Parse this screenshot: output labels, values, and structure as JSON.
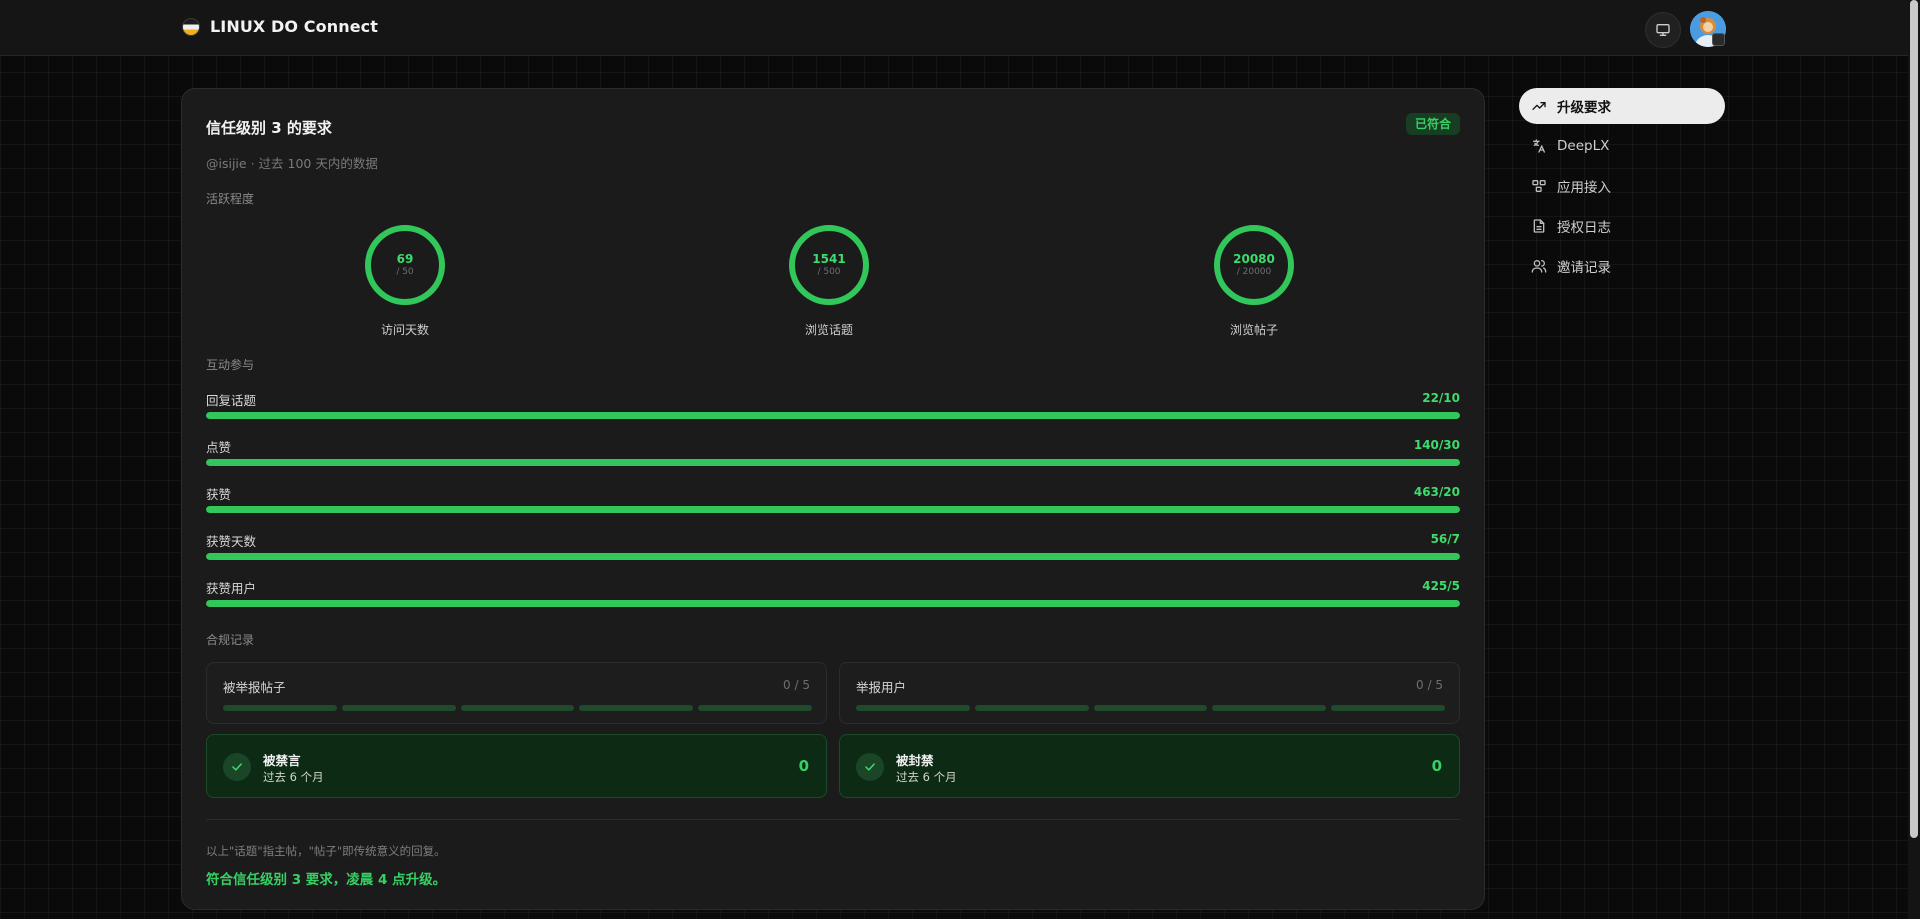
{
  "header": {
    "brand_name": "LINUX DO Connect",
    "display_icon": "monitor-icon",
    "avatar": "user-avatar"
  },
  "card": {
    "title": "信任级别 3 的要求",
    "status_badge": "已符合",
    "subtitle": "@isijie · 过去 100 天内的数据"
  },
  "activity": {
    "label": "活跃程度",
    "rings": [
      {
        "value": "69",
        "target": "/ 50",
        "label": "访问天数",
        "progress": 1.0
      },
      {
        "value": "1541",
        "target": "/ 500",
        "label": "浏览话题",
        "progress": 1.0
      },
      {
        "value": "20080",
        "target": "/ 20000",
        "label": "浏览帖子",
        "progress": 1.0
      }
    ]
  },
  "interaction": {
    "label": "互动参与",
    "bars": [
      {
        "label": "回复话题",
        "value": "22/10",
        "progress": 1.0
      },
      {
        "label": "点赞",
        "value": "140/30",
        "progress": 1.0
      },
      {
        "label": "获赞",
        "value": "463/20",
        "progress": 1.0
      },
      {
        "label": "获赞天数",
        "value": "56/7",
        "progress": 1.0
      },
      {
        "label": "获赞用户",
        "value": "425/5",
        "progress": 1.0
      }
    ]
  },
  "compliance": {
    "label": "合规记录",
    "limits": [
      {
        "title": "被举报帖子",
        "value": "0 / 5",
        "used": 0,
        "max": 5
      },
      {
        "title": "举报用户",
        "value": "0 / 5",
        "used": 0,
        "max": 5
      }
    ],
    "checks": [
      {
        "title": "被禁言",
        "sub": "过去 6 个月",
        "value": "0"
      },
      {
        "title": "被封禁",
        "sub": "过去 6 个月",
        "value": "0"
      }
    ]
  },
  "footer": {
    "note": "以上\"话题\"指主帖，\"帖子\"即传统意义的回复。",
    "conclusion": "符合信任级别 3 要求，凌晨 4 点升级。"
  },
  "nav": {
    "items": [
      {
        "label": "升级要求",
        "icon": "trending-up-icon",
        "active": true
      },
      {
        "label": "DeepLX",
        "icon": "translate-icon",
        "active": false
      },
      {
        "label": "应用接入",
        "icon": "apps-icon",
        "active": false
      },
      {
        "label": "授权日志",
        "icon": "document-icon",
        "active": false
      },
      {
        "label": "邀请记录",
        "icon": "users-icon",
        "active": false
      }
    ]
  },
  "colors": {
    "accent": "#31c75a",
    "accent_text": "#3ddc6c",
    "card_bg": "#1b1b1b",
    "ok_bg": "#0d2a15"
  }
}
